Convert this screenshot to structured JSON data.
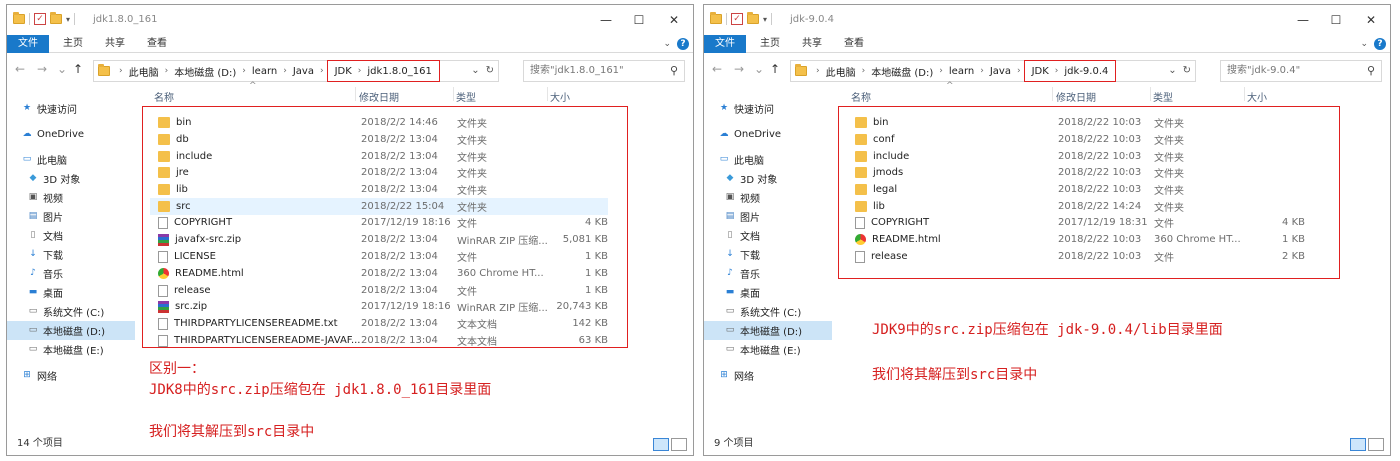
{
  "windows": [
    {
      "title": "jdk1.8.0_161",
      "ribbon_tabs": [
        "文件",
        "主页",
        "共享",
        "查看"
      ],
      "address": {
        "parts": [
          "此电脑",
          "本地磁盘 (D:)",
          "learn",
          "Java"
        ],
        "highlighted": [
          "JDK",
          "jdk1.8.0_161"
        ]
      },
      "search_placeholder": "搜索\"jdk1.8.0_161\"",
      "columns": [
        "名称",
        "修改日期",
        "类型",
        "大小"
      ],
      "files": [
        {
          "name": "bin",
          "date": "2018/2/2 14:46",
          "type": "文件夹",
          "size": "",
          "icon": "folder"
        },
        {
          "name": "db",
          "date": "2018/2/2 13:04",
          "type": "文件夹",
          "size": "",
          "icon": "folder"
        },
        {
          "name": "include",
          "date": "2018/2/2 13:04",
          "type": "文件夹",
          "size": "",
          "icon": "folder"
        },
        {
          "name": "jre",
          "date": "2018/2/2 13:04",
          "type": "文件夹",
          "size": "",
          "icon": "folder"
        },
        {
          "name": "lib",
          "date": "2018/2/2 13:04",
          "type": "文件夹",
          "size": "",
          "icon": "folder"
        },
        {
          "name": "src",
          "date": "2018/2/22 15:04",
          "type": "文件夹",
          "size": "",
          "icon": "folder"
        },
        {
          "name": "COPYRIGHT",
          "date": "2017/12/19 18:16",
          "type": "文件",
          "size": "4 KB",
          "icon": "file"
        },
        {
          "name": "javafx-src.zip",
          "date": "2018/2/2 13:04",
          "type": "WinRAR ZIP 压缩...",
          "size": "5,081 KB",
          "icon": "zip"
        },
        {
          "name": "LICENSE",
          "date": "2018/2/2 13:04",
          "type": "文件",
          "size": "1 KB",
          "icon": "file"
        },
        {
          "name": "README.html",
          "date": "2018/2/2 13:04",
          "type": "360 Chrome HT...",
          "size": "1 KB",
          "icon": "chrome"
        },
        {
          "name": "release",
          "date": "2018/2/2 13:04",
          "type": "文件",
          "size": "1 KB",
          "icon": "file"
        },
        {
          "name": "src.zip",
          "date": "2017/12/19 18:16",
          "type": "WinRAR ZIP 压缩...",
          "size": "20,743 KB",
          "icon": "zip"
        },
        {
          "name": "THIRDPARTYLICENSEREADME.txt",
          "date": "2018/2/2 13:04",
          "type": "文本文档",
          "size": "142 KB",
          "icon": "file"
        },
        {
          "name": "THIRDPARTYLICENSEREADME-JAVAF...",
          "date": "2018/2/2 13:04",
          "type": "文本文档",
          "size": "63 KB",
          "icon": "file"
        }
      ],
      "highlighted_row": 5,
      "status": "14 个项目",
      "notes": [
        "区别一：",
        "JDK8中的src.zip压缩包在 jdk1.8.0_161目录里面",
        "我们将其解压到src目录中"
      ]
    },
    {
      "title": "jdk-9.0.4",
      "ribbon_tabs": [
        "文件",
        "主页",
        "共享",
        "查看"
      ],
      "address": {
        "parts": [
          "此电脑",
          "本地磁盘 (D:)",
          "learn",
          "Java"
        ],
        "highlighted": [
          "JDK",
          "jdk-9.0.4"
        ]
      },
      "search_placeholder": "搜索\"jdk-9.0.4\"",
      "columns": [
        "名称",
        "修改日期",
        "类型",
        "大小"
      ],
      "files": [
        {
          "name": "bin",
          "date": "2018/2/22 10:03",
          "type": "文件夹",
          "size": "",
          "icon": "folder"
        },
        {
          "name": "conf",
          "date": "2018/2/22 10:03",
          "type": "文件夹",
          "size": "",
          "icon": "folder"
        },
        {
          "name": "include",
          "date": "2018/2/22 10:03",
          "type": "文件夹",
          "size": "",
          "icon": "folder"
        },
        {
          "name": "jmods",
          "date": "2018/2/22 10:03",
          "type": "文件夹",
          "size": "",
          "icon": "folder"
        },
        {
          "name": "legal",
          "date": "2018/2/22 10:03",
          "type": "文件夹",
          "size": "",
          "icon": "folder"
        },
        {
          "name": "lib",
          "date": "2018/2/22 14:24",
          "type": "文件夹",
          "size": "",
          "icon": "folder"
        },
        {
          "name": "COPYRIGHT",
          "date": "2017/12/19 18:31",
          "type": "文件",
          "size": "4 KB",
          "icon": "file"
        },
        {
          "name": "README.html",
          "date": "2018/2/22 10:03",
          "type": "360 Chrome HT...",
          "size": "1 KB",
          "icon": "chrome"
        },
        {
          "name": "release",
          "date": "2018/2/22 10:03",
          "type": "文件",
          "size": "2 KB",
          "icon": "file"
        }
      ],
      "highlighted_row": -1,
      "status": "9 个项目",
      "notes": [
        "JDK9中的src.zip压缩包在 jdk-9.0.4/lib目录里面",
        "我们将其解压到src目录中"
      ]
    }
  ],
  "nav_items": [
    {
      "label": "快速访问",
      "icon": "star-icon"
    },
    {
      "label": "OneDrive",
      "icon": "cloud-icon"
    },
    {
      "label": "此电脑",
      "icon": "computer-icon"
    },
    {
      "label": "3D 对象",
      "icon": "cube-icon"
    },
    {
      "label": "视频",
      "icon": "video-icon"
    },
    {
      "label": "图片",
      "icon": "picture-icon"
    },
    {
      "label": "文档",
      "icon": "document-icon"
    },
    {
      "label": "下载",
      "icon": "download-icon"
    },
    {
      "label": "音乐",
      "icon": "music-icon"
    },
    {
      "label": "桌面",
      "icon": "desktop-icon"
    },
    {
      "label": "系统文件 (C:)",
      "icon": "drive-icon"
    },
    {
      "label": "本地磁盘 (D:)",
      "icon": "drive-icon"
    },
    {
      "label": "本地磁盘 (E:)",
      "icon": "drive-icon"
    },
    {
      "label": "网络",
      "icon": "network-icon"
    }
  ],
  "selected_nav": 11,
  "colors": {
    "accent": "#1979ca",
    "annotation": "#d62020",
    "selection": "#cce4f7"
  }
}
